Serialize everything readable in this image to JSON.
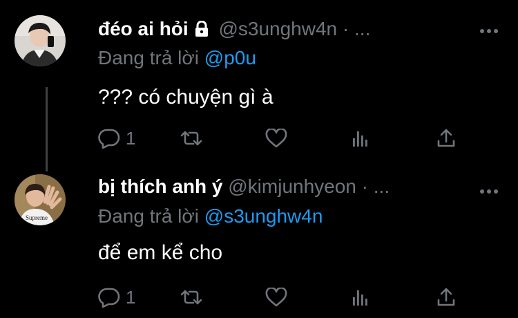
{
  "tweets": [
    {
      "display_name": "đéo ai hỏi",
      "protected": true,
      "handle": "@s3unghw4n",
      "dot": "·",
      "time": "...",
      "reply_prefix": "Đang trả lời",
      "reply_to": "@p0u",
      "text": "??? có chuyện gì à",
      "reply_count": "1",
      "more_icon": "more-horizontal-icon"
    },
    {
      "display_name": "bị thích anh ý",
      "protected": false,
      "handle": "@kimjunhyeon",
      "dot": "·",
      "time": "...",
      "reply_prefix": "Đang trả lời",
      "reply_to": "@s3unghw4n",
      "text": "để em kể cho",
      "reply_count": "1",
      "more_icon": "more-horizontal-icon"
    }
  ],
  "icons": {
    "reply": "reply-icon",
    "retweet": "retweet-icon",
    "like": "heart-icon",
    "views": "analytics-icon",
    "share": "share-icon",
    "lock": "lock-icon"
  },
  "colors": {
    "background": "#000000",
    "text_primary": "#ffffff",
    "text_secondary": "#71767b",
    "mention": "#1d9bf0",
    "thread_line": "#3e4144"
  }
}
